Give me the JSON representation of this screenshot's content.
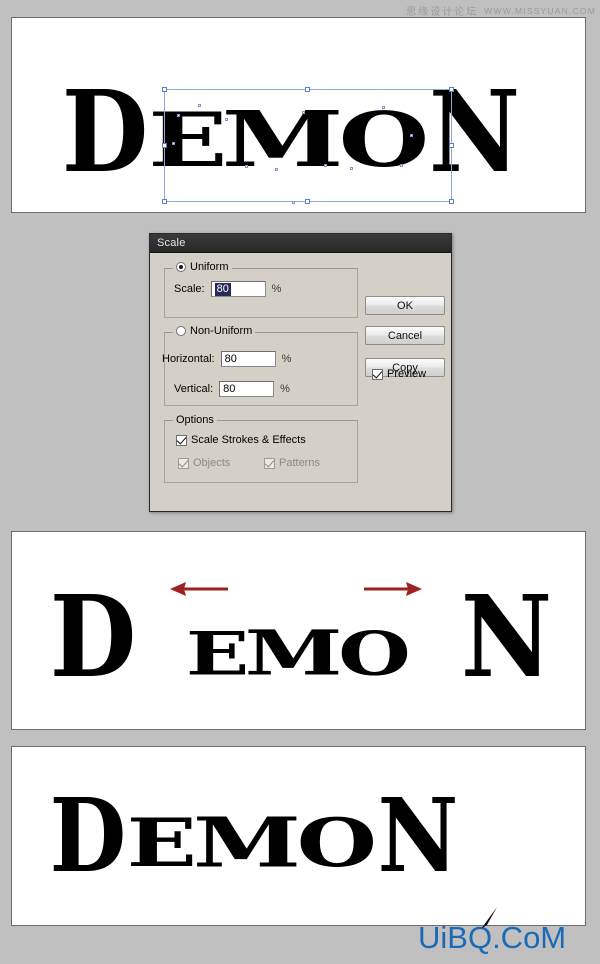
{
  "watermark": {
    "chinese": "思缘设计论坛",
    "url": "WWW.MISSYUAN.COM"
  },
  "artwork": {
    "word": "DEMON",
    "letters": [
      "D",
      "E",
      "M",
      "O",
      "N"
    ],
    "middle_cluster": [
      "E",
      "M",
      "O"
    ],
    "color": "#000000"
  },
  "panels": [
    {
      "name": "before-scale",
      "caption": ""
    },
    {
      "name": "after-scale-with-gaps",
      "caption": ""
    },
    {
      "name": "final-result",
      "caption": ""
    }
  ],
  "selection": {
    "label": "selection-bounding-box",
    "stroke_color": "#8fa8d8",
    "handle_fill": "#ffffff"
  },
  "arrows": {
    "color": "#9e2122",
    "left_label": "move-left-arrow",
    "right_label": "move-right-arrow"
  },
  "dialog": {
    "title": "Scale",
    "uniform": {
      "legend": "Uniform",
      "selected": true,
      "scale_label": "Scale:",
      "scale_value": "80",
      "percent": "%"
    },
    "non_uniform": {
      "legend": "Non-Uniform",
      "selected": false,
      "horizontal_label": "Horizontal:",
      "horizontal_value": "80",
      "horizontal_percent": "%",
      "vertical_label": "Vertical:",
      "vertical_value": "80",
      "vertical_percent": "%"
    },
    "options": {
      "legend": "Options",
      "scale_strokes_label": "Scale Strokes & Effects",
      "scale_strokes_checked": true,
      "objects_label": "Objects",
      "objects_checked": true,
      "objects_disabled": true,
      "patterns_label": "Patterns",
      "patterns_checked": true,
      "patterns_disabled": true
    },
    "buttons": {
      "ok": "OK",
      "cancel": "Cancel",
      "copy": "Copy"
    },
    "preview": {
      "label": "Preview",
      "checked": true
    }
  },
  "logo": {
    "text": "UiBQ.CoM",
    "color": "#1b69b7"
  }
}
